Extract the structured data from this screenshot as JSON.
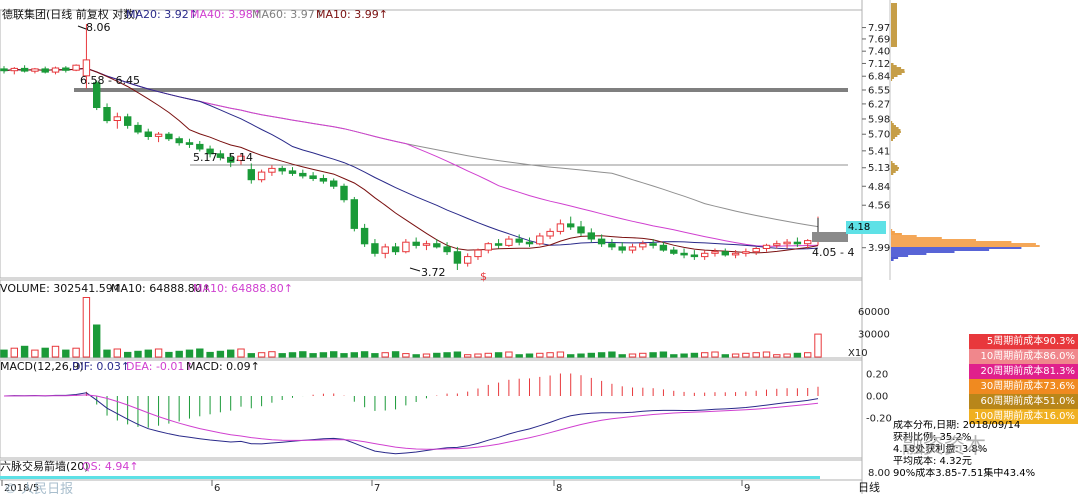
{
  "header": {
    "stock_name": "德联集团(日线 前复权 对数)",
    "ma20": "MA20: 3.92↑",
    "ma40": "MA40: 3.98↑",
    "ma60": "MA60: 3.97↑",
    "ma10": "MA10: 3.99↑"
  },
  "price_labels": {
    "high": "8.06",
    "low": "3.72",
    "zone1": "6.58 - 6.45",
    "zone2": "5.17 - 5.14",
    "current": "4.18",
    "right_range": "4.05 - 4",
    "s_marker": "$"
  },
  "volume_header": {
    "volume": "VOLUME: 302541.59↑",
    "ma10a": "MA10: 64888.80↑",
    "ma10b": "MA10: 64888.80↑"
  },
  "macd_header": {
    "title": "MACD(12,26,9)",
    "dif": "DIF: 0.03↑",
    "dea": "DEA: -0.01↑",
    "macd": "MACD: 0.09↑"
  },
  "indicator4": {
    "title": "六脉交易箭墙(20)",
    "value": "QS: 4.94↑"
  },
  "x_axis": {
    "labels": [
      "2018/5",
      "6",
      "7",
      "8",
      "9"
    ],
    "period": "日线"
  },
  "axes": {
    "price_ticks": [
      "7.97",
      "7.69",
      "7.40",
      "7.12",
      "6.84",
      "6.55",
      "6.27",
      "5.98",
      "5.70",
      "5.41",
      "5.13",
      "4.84",
      "4.56",
      "3.99"
    ],
    "volume_ticks": [
      "60000",
      "30000"
    ],
    "volume_unit": "X10",
    "macd_ticks": [
      "0.20",
      "0.00",
      "-0.20"
    ],
    "ind_ticks": [
      "8.00"
    ]
  },
  "cost_legend": [
    {
      "label": "5周期前成本90.3%",
      "color": "#e8383c"
    },
    {
      "label": "10周期前成本86.0%",
      "color": "#f0878c"
    },
    {
      "label": "20周期前成本81.3%",
      "color": "#e0208c"
    },
    {
      "label": "30周期前成本73.6%",
      "color": "#f08a20"
    },
    {
      "label": "60周期前成本51.0%",
      "color": "#b8861a"
    },
    {
      "label": "100周期前成本16.0%",
      "color": "#f0b020"
    }
  ],
  "cost_info": {
    "line1": "成本分布,日期: 2018/09/14",
    "line2": "获利比例: 35.2%",
    "line3": "4.18处获利盘: 3.8%",
    "line4": "平均成本: 4.32元",
    "line5": "90%成本3.85-7.51集中43.4%"
  },
  "watermark": {
    "right": "融资资本",
    "left": "© 人民日报"
  },
  "chart_data": {
    "type": "candlestick",
    "title": "德联集团(日线 前复权 对数)",
    "y_scale": "log",
    "ylim": [
      3.72,
      8.06
    ],
    "x_labels": [
      "2018/5",
      "6",
      "7",
      "8",
      "9"
    ],
    "ohlc_approx": [
      [
        7.0,
        7.06,
        6.9,
        6.96
      ],
      [
        6.96,
        7.04,
        6.88,
        7.01
      ],
      [
        7.01,
        7.08,
        6.92,
        6.95
      ],
      [
        6.95,
        7.02,
        6.9,
        7.0
      ],
      [
        7.0,
        7.05,
        6.9,
        6.93
      ],
      [
        6.93,
        7.05,
        6.88,
        7.02
      ],
      [
        7.02,
        7.06,
        6.92,
        6.97
      ],
      [
        6.97,
        7.1,
        6.95,
        7.08
      ],
      [
        6.85,
        8.06,
        6.58,
        7.2
      ],
      [
        6.7,
        6.75,
        6.15,
        6.2
      ],
      [
        6.2,
        6.28,
        5.9,
        5.95
      ],
      [
        5.95,
        6.1,
        5.8,
        6.02
      ],
      [
        6.02,
        6.08,
        5.8,
        5.86
      ],
      [
        5.86,
        5.92,
        5.7,
        5.74
      ],
      [
        5.74,
        5.8,
        5.6,
        5.66
      ],
      [
        5.66,
        5.74,
        5.56,
        5.7
      ],
      [
        5.7,
        5.74,
        5.58,
        5.62
      ],
      [
        5.62,
        5.66,
        5.5,
        5.55
      ],
      [
        5.55,
        5.62,
        5.46,
        5.52
      ],
      [
        5.52,
        5.58,
        5.4,
        5.44
      ],
      [
        5.44,
        5.5,
        5.3,
        5.36
      ],
      [
        5.36,
        5.42,
        5.25,
        5.3
      ],
      [
        5.3,
        5.36,
        5.14,
        5.22
      ],
      [
        5.25,
        5.36,
        5.18,
        5.32
      ],
      [
        5.1,
        5.2,
        4.88,
        4.94
      ],
      [
        4.94,
        5.1,
        4.9,
        5.06
      ],
      [
        5.06,
        5.17,
        5.0,
        5.12
      ],
      [
        5.12,
        5.16,
        5.02,
        5.08
      ],
      [
        5.08,
        5.14,
        5.0,
        5.04
      ],
      [
        5.04,
        5.1,
        4.96,
        5.0
      ],
      [
        5.0,
        5.06,
        4.92,
        4.96
      ],
      [
        4.96,
        5.02,
        4.88,
        4.92
      ],
      [
        4.92,
        4.96,
        4.8,
        4.84
      ],
      [
        4.84,
        4.88,
        4.6,
        4.64
      ],
      [
        4.64,
        4.68,
        4.2,
        4.24
      ],
      [
        4.24,
        4.3,
        4.0,
        4.04
      ],
      [
        4.04,
        4.1,
        3.88,
        3.92
      ],
      [
        3.92,
        4.04,
        3.86,
        4.0
      ],
      [
        4.0,
        4.05,
        3.9,
        3.94
      ],
      [
        3.94,
        4.1,
        3.92,
        4.06
      ],
      [
        4.06,
        4.12,
        3.98,
        4.02
      ],
      [
        4.02,
        4.08,
        3.96,
        4.04
      ],
      [
        4.04,
        4.1,
        3.98,
        4.0
      ],
      [
        4.0,
        4.06,
        3.9,
        3.94
      ],
      [
        3.94,
        4.0,
        3.72,
        3.8
      ],
      [
        3.8,
        3.92,
        3.76,
        3.88
      ],
      [
        3.88,
        3.98,
        3.84,
        3.96
      ],
      [
        3.96,
        4.06,
        3.92,
        4.04
      ],
      [
        4.04,
        4.1,
        3.98,
        4.02
      ],
      [
        4.02,
        4.14,
        4.0,
        4.1
      ],
      [
        4.1,
        4.16,
        4.02,
        4.06
      ],
      [
        4.06,
        4.12,
        4.0,
        4.04
      ],
      [
        4.04,
        4.18,
        4.02,
        4.14
      ],
      [
        4.14,
        4.24,
        4.1,
        4.2
      ],
      [
        4.2,
        4.36,
        4.16,
        4.3
      ],
      [
        4.3,
        4.4,
        4.22,
        4.26
      ],
      [
        4.26,
        4.34,
        4.14,
        4.18
      ],
      [
        4.18,
        4.24,
        4.06,
        4.1
      ],
      [
        4.1,
        4.16,
        4.0,
        4.04
      ],
      [
        4.04,
        4.1,
        3.96,
        4.0
      ],
      [
        4.0,
        4.06,
        3.92,
        3.96
      ],
      [
        3.96,
        4.04,
        3.92,
        4.0
      ],
      [
        4.0,
        4.08,
        3.96,
        4.04
      ],
      [
        4.04,
        4.1,
        3.98,
        4.02
      ],
      [
        4.02,
        4.06,
        3.94,
        3.96
      ],
      [
        3.96,
        4.0,
        3.9,
        3.92
      ],
      [
        3.92,
        3.98,
        3.86,
        3.9
      ],
      [
        3.9,
        3.96,
        3.84,
        3.88
      ],
      [
        3.88,
        3.96,
        3.84,
        3.92
      ],
      [
        3.92,
        3.98,
        3.88,
        3.94
      ],
      [
        3.94,
        3.98,
        3.88,
        3.9
      ],
      [
        3.9,
        3.96,
        3.86,
        3.92
      ],
      [
        3.92,
        3.98,
        3.88,
        3.94
      ],
      [
        3.94,
        4.0,
        3.9,
        3.98
      ],
      [
        3.98,
        4.04,
        3.94,
        4.02
      ],
      [
        4.02,
        4.08,
        3.98,
        4.04
      ],
      [
        4.04,
        4.1,
        3.98,
        4.06
      ],
      [
        4.06,
        4.12,
        4.0,
        4.04
      ],
      [
        4.04,
        4.1,
        3.98,
        4.08
      ],
      [
        4.08,
        4.4,
        4.02,
        4.18
      ]
    ],
    "volume_ylim": [
      0,
      80000
    ],
    "macd_ylim": [
      -0.3,
      0.25
    ],
    "overlays": [
      "MA10",
      "MA20",
      "MA40",
      "MA60"
    ],
    "grid": false
  },
  "colors": {
    "up": "#e8383c",
    "down": "#1a9a38",
    "ma10": "#7a1010",
    "ma20": "#2a2a8a",
    "ma40": "#d040d0",
    "ma60": "#909090",
    "dif": "#2a2a8a",
    "dea": "#d040d0"
  }
}
